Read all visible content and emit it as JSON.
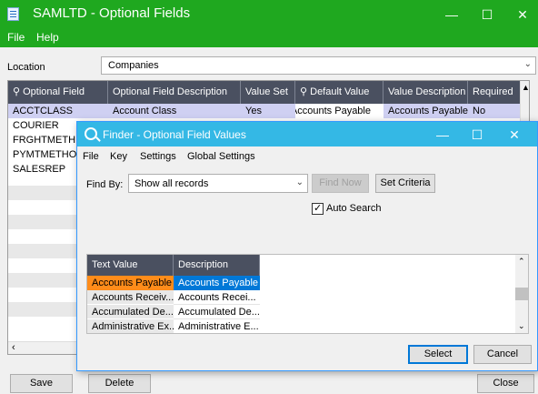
{
  "window": {
    "title": "SAMLTD - Optional Fields",
    "minimize_glyph": "—",
    "maximize_glyph": "☐",
    "close_glyph": "✕"
  },
  "menu": {
    "file": "File",
    "help": "Help"
  },
  "location": {
    "label": "Location",
    "value": "Companies"
  },
  "grid": {
    "columns": [
      "Optional Field",
      "Optional Field Description",
      "Value Set",
      "Default Value",
      "Value Description",
      "Required"
    ],
    "rows": [
      {
        "field": "ACCTCLASS",
        "description": "Account Class",
        "value_set": "Yes",
        "default_value": "Accounts Payable",
        "value_description": "Accounts Payable",
        "required": "No"
      },
      {
        "field": "COURIER"
      },
      {
        "field": "FRGHTMETH"
      },
      {
        "field": "PYMTMETHOD"
      },
      {
        "field": "SALESREP"
      }
    ]
  },
  "buttons": {
    "save": "Save",
    "delete": "Delete",
    "close": "Close"
  },
  "finder": {
    "title": "Finder - Optional Field Values",
    "menu": [
      "File",
      "Key",
      "Settings",
      "Global Settings"
    ],
    "find_by_label": "Find By:",
    "find_by_value": "Show all records",
    "find_now": "Find Now",
    "set_criteria": "Set Criteria",
    "auto_search_label": "Auto Search",
    "auto_search_checked": true,
    "columns": [
      "Text Value",
      "Description"
    ],
    "rows": [
      {
        "text": "Accounts Payable",
        "desc": "Accounts Payable"
      },
      {
        "text": "Accounts Receiv...",
        "desc": "Accounts Recei..."
      },
      {
        "text": "Accumulated De...",
        "desc": "Accumulated De..."
      },
      {
        "text": "Administrative Ex...",
        "desc": "Administrative E..."
      }
    ],
    "select": "Select",
    "cancel": "Cancel",
    "colors": {
      "selected_text_bg": "#ff8c1a",
      "selected_desc_bg": "#0078d7"
    }
  },
  "colors": {
    "title_bar": "#1fa81f",
    "finder_title_bar": "#34b8e5",
    "grid_header": "#4a5060",
    "selected_row": "#cfd0f2"
  }
}
